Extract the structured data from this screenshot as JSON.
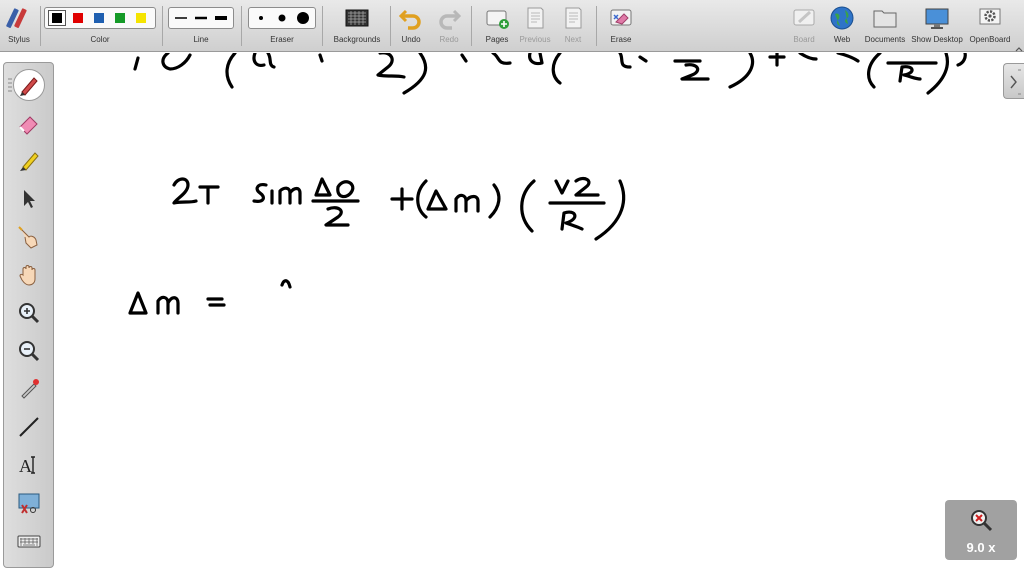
{
  "toolbar": {
    "stylus": "Stylus",
    "color": "Color",
    "line": "Line",
    "eraser": "Eraser",
    "backgrounds": "Backgrounds",
    "undo": "Undo",
    "redo": "Redo",
    "pages": "Pages",
    "previous": "Previous",
    "next": "Next",
    "erase": "Erase",
    "board": "Board",
    "web": "Web",
    "documents": "Documents",
    "show_desktop": "Show Desktop",
    "openboard": "OpenBoard"
  },
  "colors": [
    "#000000",
    "#e00000",
    "#1f5fb0",
    "#159a28",
    "#f5e400"
  ],
  "selected_color": "#000000",
  "zoom": {
    "label": "9.0 x"
  },
  "palette": [
    "pen-tool",
    "eraser-tool",
    "marker-tool",
    "selector-tool",
    "interact-tool",
    "hand-tool",
    "zoom-in-tool",
    "zoom-out-tool",
    "laser-pointer-tool",
    "line-tool",
    "text-tool",
    "capture-tool",
    "virtual-keyboard-tool"
  ]
}
